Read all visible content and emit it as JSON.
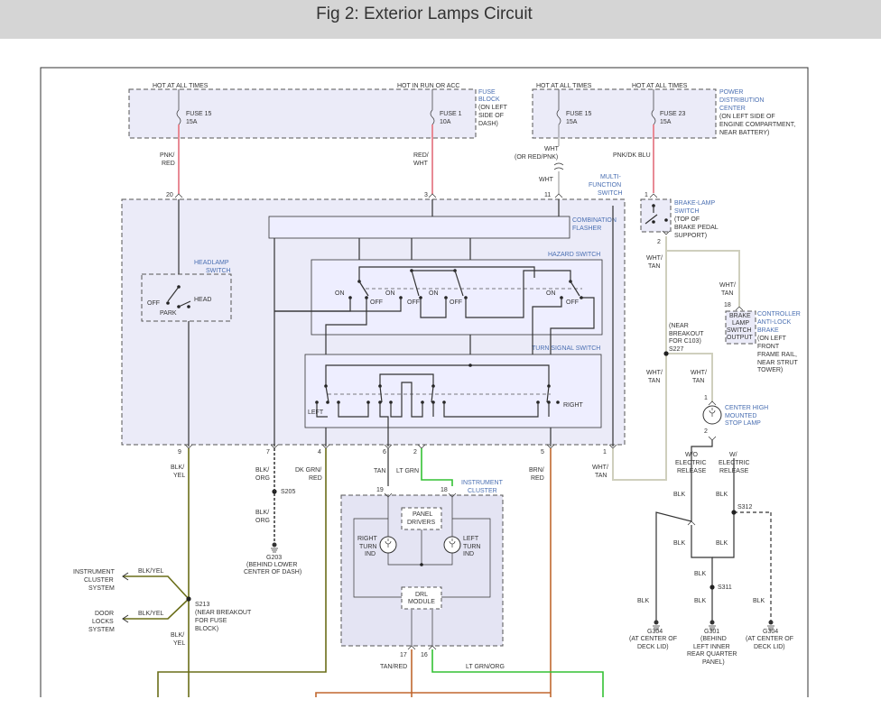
{
  "page": {
    "title": "Fig 2: Exterior Lamps Circuit"
  },
  "diagram": {
    "fuse_block": {
      "hot_always": "HOT AT ALL TIMES",
      "hot_run_acc": "HOT IN RUN OR ACC",
      "fuse15_name": "FUSE 15",
      "fuse15_amp": "15A",
      "fuse1_name": "FUSE 1",
      "fuse1_amp": "10A",
      "label_l1": "FUSE",
      "label_l2": "BLOCK",
      "label_l3": "(ON LEFT",
      "label_l4": "SIDE OF",
      "label_l5": "DASH)"
    },
    "pdc": {
      "hot_always_1": "HOT AT ALL TIMES",
      "hot_always_2": "HOT AT ALL TIMES",
      "fuse15_name": "FUSE 15",
      "fuse15_amp": "15A",
      "fuse23_name": "FUSE 23",
      "fuse23_amp": "15A",
      "label_l1": "POWER",
      "label_l2": "DISTRIBUTION",
      "label_l3": "CENTER",
      "label_l4": "(ON LEFT SIDE OF",
      "label_l5": "ENGINE COMPARTMENT,",
      "label_l6": "NEAR BATTERY)"
    },
    "wires_top": {
      "pnk_red_l1": "PNK/",
      "pnk_red_l2": "RED",
      "red_wht_l1": "RED/",
      "red_wht_l2": "WHT",
      "wht_l1": "WHT",
      "wht_l2": "(OR RED/PNK)",
      "wht_l3": "WHT",
      "pnk_dkblu": "PNK/DK BLU"
    },
    "mfs": {
      "label_l1": "MULTI-",
      "label_l2": "FUNCTION",
      "label_l3": "SWITCH",
      "pin20": "20",
      "pin3": "3",
      "pin11": "11",
      "flasher_l1": "COMBINATION",
      "flasher_l2": "FLASHER",
      "headlamp_l1": "HEADLAMP",
      "headlamp_l2": "SWITCH",
      "off": "OFF",
      "park": "PARK",
      "head": "HEAD",
      "hazard": "HAZARD SWITCH",
      "on1": "ON",
      "off1": "OFF",
      "on2": "ON",
      "off2": "OFF",
      "on3": "ON",
      "off3": "OFF",
      "on4": "ON",
      "off4": "OFF",
      "turn_signal": "TURN SIGNAL SWITCH",
      "left": "LEFT",
      "right": "RIGHT",
      "pin9": "9",
      "pin7": "7",
      "pin4": "4",
      "pin6": "6",
      "pin2": "2",
      "pin5": "5",
      "pin1": "1"
    },
    "brake_switch": {
      "pin1": "1",
      "pin2": "2",
      "label_l1": "BRAKE-LAMP",
      "label_l2": "SWITCH",
      "label_l3": "(TOP OF",
      "label_l4": "BRAKE PEDAL",
      "label_l5": "SUPPORT)",
      "wht_tan_l1": "WHT/",
      "wht_tan_l2": "TAN"
    },
    "abs": {
      "wht_tan_l1": "WHT/",
      "wht_tan_l2": "TAN",
      "pin18": "18",
      "box_l1": "BRAKE",
      "box_l2": "LAMP",
      "box_l3": "SWITCH",
      "box_l4": "OUTPUT",
      "label_l1": "CONTROLLER",
      "label_l2": "ANTI-LOCK",
      "label_l3": "BRAKE",
      "label_l4": "(ON LEFT",
      "label_l5": "FRONT",
      "label_l6": "FRAME RAIL,",
      "label_l7": "NEAR STRUT",
      "label_l8": "TOWER)"
    },
    "s227": {
      "l1": "(NEAR",
      "l2": "BREAKOUT",
      "l3": "FOR C103)",
      "l4": "S227",
      "wht_tan_a1": "WHT/",
      "wht_tan_a2": "TAN",
      "wht_tan_b1": "WHT/",
      "wht_tan_b2": "TAN"
    },
    "chmsl": {
      "pin1": "1",
      "pin2": "2",
      "label_l1": "CENTER HIGH",
      "label_l2": "MOUNTED",
      "label_l3": "STOP LAMP",
      "wo_l1": "W/O",
      "wo_l2": "ELECTRIC",
      "wo_l3": "RELEASE",
      "w_l1": "W/",
      "w_l2": "ELECTRIC",
      "w_l3": "RELEASE"
    },
    "lower_wires": {
      "blk_yel_l1": "BLK/",
      "blk_yel_l2": "YEL",
      "blk_org_l1": "BLK/",
      "blk_org_l2": "ORG",
      "s205": "S205",
      "blk_org2_l1": "BLK/",
      "blk_org2_l2": "ORG",
      "g203": "G203",
      "g203_l1": "(BEHIND LOWER",
      "g203_l2": "CENTER OF DASH)",
      "dkgrn_red_l1": "DK GRN/",
      "dkgrn_red_l2": "RED",
      "tan": "TAN",
      "ltgrn": "LT GRN",
      "brn_red_l1": "BRN/",
      "brn_red_l2": "RED",
      "wht_tan_l1": "WHT/",
      "wht_tan_l2": "TAN"
    },
    "cluster": {
      "label_l1": "INSTRUMENT",
      "label_l2": "CLUSTER",
      "pin19": "19",
      "pin18": "18",
      "panel_l1": "PANEL",
      "panel_l2": "DRIVERS",
      "right_l1": "RIGHT",
      "right_l2": "TURN",
      "right_l3": "IND",
      "left_l1": "LEFT",
      "left_l2": "TURN",
      "left_l3": "IND",
      "drl_l1": "DRL",
      "drl_l2": "MODULE",
      "pin17": "17",
      "pin16": "16",
      "tan_red": "TAN/RED",
      "ltgrn_org": "LT GRN/ORG"
    },
    "s213": {
      "ic_l1": "INSTRUMENT",
      "ic_l2": "CLUSTER",
      "ic_l3": "SYSTEM",
      "dl_l1": "DOOR",
      "dl_l2": "LOCKS",
      "dl_l3": "SYSTEM",
      "blk_yel_a": "BLK/YEL",
      "blk_yel_b": "BLK/YEL",
      "name": "S213",
      "l1": "(NEAR BREAKOUT",
      "l2": "FOR FUSE",
      "l3": "BLOCK)",
      "blk_yel_l1": "BLK/",
      "blk_yel_l2": "YEL"
    },
    "grounds": {
      "blk1": "BLK",
      "blk2": "BLK",
      "s312": "S312",
      "blk3": "BLK",
      "blk4": "BLK",
      "blk5": "BLK",
      "s311": "S311",
      "blk6": "BLK",
      "blk7": "BLK",
      "blk8": "BLK",
      "g304a": "G304",
      "g304a_l1": "(AT CENTER OF",
      "g304a_l2": "DECK LID)",
      "g301": "G301",
      "g301_l1": "(BEHIND",
      "g301_l2": "LEFT INNER",
      "g301_l3": "REAR QUARTER",
      "g301_l4": "PANEL)",
      "g304b": "G304",
      "g304b_l1": "(AT CENTER OF",
      "g304b_l2": "DECK LID)"
    },
    "colors": {
      "pink": "#e88a95",
      "green": "#34c134",
      "olive": "#6a6e19",
      "brown": "#c0672e",
      "gray": "#cfcfbd"
    }
  }
}
